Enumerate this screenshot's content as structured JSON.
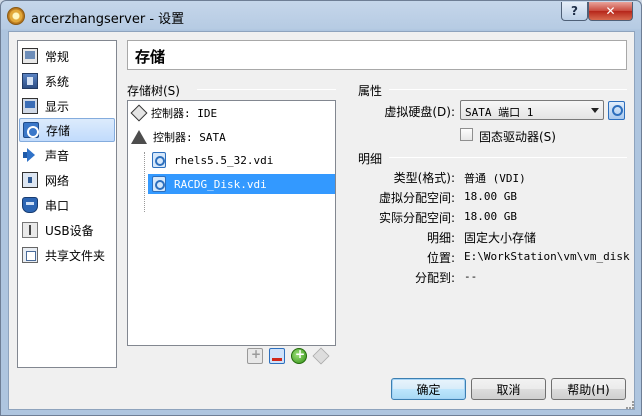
{
  "window": {
    "title": "arcerzhangserver - 设置",
    "help_glyph": "?",
    "close_glyph": "✕"
  },
  "sidebar": {
    "items": [
      {
        "label": "常规",
        "icon": "general-icon"
      },
      {
        "label": "系统",
        "icon": "system-icon"
      },
      {
        "label": "显示",
        "icon": "display-icon"
      },
      {
        "label": "存储",
        "icon": "storage-icon",
        "selected": true
      },
      {
        "label": "声音",
        "icon": "audio-icon"
      },
      {
        "label": "网络",
        "icon": "network-icon"
      },
      {
        "label": "串口",
        "icon": "serial-icon"
      },
      {
        "label": "USB设备",
        "icon": "usb-icon"
      },
      {
        "label": "共享文件夹",
        "icon": "shared-folder-icon"
      }
    ]
  },
  "header": {
    "title": "存储"
  },
  "storage_tree": {
    "label": "存储树(S)",
    "controllers": [
      {
        "label": "控制器: IDE",
        "icon": "ide-controller-icon"
      },
      {
        "label": "控制器: SATA",
        "icon": "sata-controller-icon",
        "disks": [
          {
            "label": "rhels5.5_32.vdi"
          },
          {
            "label": "RACDG_Disk.vdi",
            "selected": true
          }
        ]
      }
    ],
    "toolbar": [
      "add-controller-icon",
      "remove-controller-icon",
      "add-attachment-icon",
      "remove-attachment-icon"
    ]
  },
  "attributes": {
    "heading": "属性",
    "virtual_disk_label": "虚拟硬盘(D):",
    "virtual_disk_value": "SATA 端口 1",
    "ssd_label": "固态驱动器(S)",
    "ssd_checked": false
  },
  "details": {
    "heading": "明细",
    "rows": [
      {
        "label": "类型(格式):",
        "value": "普通  (VDI)"
      },
      {
        "label": "虚拟分配空间:",
        "value": "18.00  GB"
      },
      {
        "label": "实际分配空间:",
        "value": "18.00  GB"
      },
      {
        "label": "明细:",
        "value": "固定大小存储"
      },
      {
        "label": "位置:",
        "value": "E:\\WorkStation\\vm\\vm_disk…"
      },
      {
        "label": "分配到:",
        "value": "--"
      }
    ]
  },
  "buttons": {
    "ok": "确定",
    "cancel": "取消",
    "help": "帮助(H)"
  }
}
